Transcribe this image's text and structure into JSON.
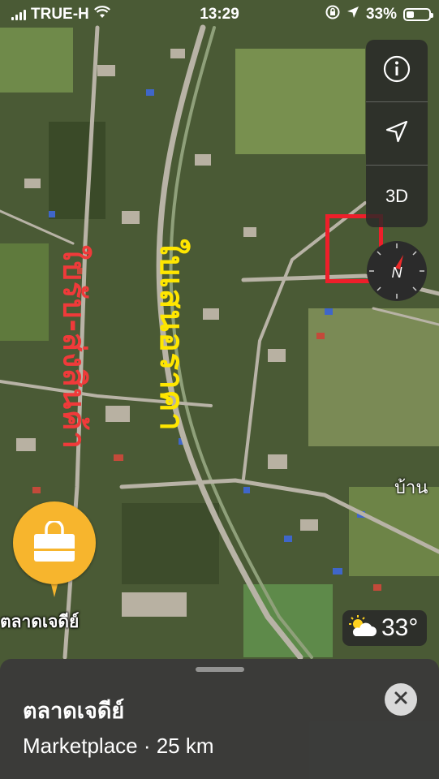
{
  "status_bar": {
    "carrier": "TRUE-H",
    "time": "13:29",
    "battery_text": "33%",
    "battery_level": 0.33
  },
  "map": {
    "overlay_text_red": "ใบรับ-ส่งสินค้า",
    "overlay_text_yellow": "ใบเสนอราคา",
    "place_label_partial": "บ้าน"
  },
  "map_controls": {
    "info_icon": "info-icon",
    "location_icon": "location-arrow-icon",
    "label_3d": "3D",
    "compass_letter": "N"
  },
  "pin": {
    "icon": "shopping-bag-icon",
    "label": "ตลาดเจดีย์",
    "color": "#f7b52d"
  },
  "weather": {
    "icon": "partly-cloudy-icon",
    "temperature": "33°"
  },
  "place_sheet": {
    "title": "ตลาดเจดีย์",
    "subtitle": "Marketplace · 25 km",
    "close_icon": "close-icon"
  },
  "colors": {
    "annotation_red": "#ee1f2a",
    "annotation_yellow": "#ffe600"
  }
}
